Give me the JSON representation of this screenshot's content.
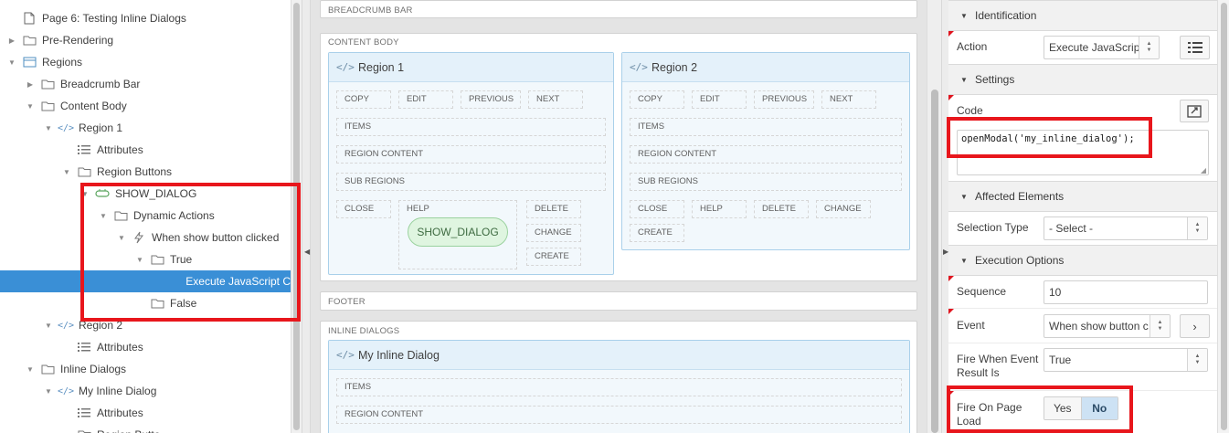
{
  "tree": {
    "items": [
      {
        "label": "Page 6: Testing Inline Dialogs",
        "icon": "page-icon",
        "level": 0,
        "toggle": "none"
      },
      {
        "label": "Pre-Rendering",
        "icon": "folder-icon",
        "level": 0,
        "toggle": "collapsed"
      },
      {
        "label": "Regions",
        "icon": "regions-icon",
        "level": 0,
        "toggle": "expanded"
      },
      {
        "label": "Breadcrumb Bar",
        "icon": "folder-icon",
        "level": 1,
        "toggle": "collapsed"
      },
      {
        "label": "Content Body",
        "icon": "folder-icon",
        "level": 1,
        "toggle": "expanded"
      },
      {
        "label": "Region 1",
        "icon": "code-icon",
        "level": 2,
        "toggle": "expanded"
      },
      {
        "label": "Attributes",
        "icon": "attributes-icon",
        "level": 3,
        "toggle": "none"
      },
      {
        "label": "Region Buttons",
        "icon": "folder-icon",
        "level": 3,
        "toggle": "expanded"
      },
      {
        "label": "SHOW_DIALOG",
        "icon": "button-icon",
        "level": 4,
        "toggle": "expanded"
      },
      {
        "label": "Dynamic Actions",
        "icon": "folder-icon",
        "level": 5,
        "toggle": "expanded"
      },
      {
        "label": "When show button clicked",
        "icon": "lightning-icon",
        "level": 6,
        "toggle": "expanded"
      },
      {
        "label": "True",
        "icon": "folder-icon",
        "level": 7,
        "toggle": "expanded"
      },
      {
        "label": "Execute JavaScript C",
        "icon": "none",
        "level": 8,
        "toggle": "none",
        "selected": true
      },
      {
        "label": "False",
        "icon": "folder-icon",
        "level": 7,
        "toggle": "none"
      },
      {
        "label": "Region 2",
        "icon": "code-icon",
        "level": 2,
        "toggle": "expanded"
      },
      {
        "label": "Attributes",
        "icon": "attributes-icon",
        "level": 3,
        "toggle": "none"
      },
      {
        "label": "Inline Dialogs",
        "icon": "folder-icon",
        "level": 1,
        "toggle": "expanded"
      },
      {
        "label": "My Inline Dialog",
        "icon": "code-icon",
        "level": 2,
        "toggle": "expanded"
      },
      {
        "label": "Attributes",
        "icon": "attributes-icon",
        "level": 3,
        "toggle": "none"
      },
      {
        "label": "Region Butto",
        "icon": "folder-icon",
        "level": 3,
        "toggle": "expanded"
      }
    ]
  },
  "layout": {
    "breadcrumb_bar": "BREADCRUMB BAR",
    "content_body": "CONTENT BODY",
    "region1": {
      "name": "Region 1",
      "top_slots": [
        "COPY",
        "EDIT",
        "PREVIOUS",
        "NEXT"
      ],
      "items": "ITEMS",
      "region_content": "REGION CONTENT",
      "sub_regions": "SUB REGIONS",
      "close": "CLOSE",
      "help": "HELP",
      "button": "SHOW_DIALOG",
      "right_slots": [
        "DELETE",
        "CHANGE",
        "CREATE"
      ]
    },
    "region2": {
      "name": "Region 2",
      "top_slots": [
        "COPY",
        "EDIT",
        "PREVIOUS",
        "NEXT"
      ],
      "items": "ITEMS",
      "region_content": "REGION CONTENT",
      "sub_regions": "SUB REGIONS",
      "bottom_slots": [
        "CLOSE",
        "HELP",
        "DELETE",
        "CHANGE"
      ],
      "create": "CREATE"
    },
    "footer": "FOOTER",
    "inline_dialogs": "INLINE DIALOGS",
    "dialog": {
      "name": "My Inline Dialog",
      "items": "ITEMS",
      "region_content": "REGION CONTENT"
    }
  },
  "props": {
    "identification": {
      "title": "Identification",
      "action_label": "Action",
      "action_value": "Execute JavaScript"
    },
    "settings": {
      "title": "Settings",
      "code_label": "Code",
      "code_value": "openModal('my_inline_dialog');"
    },
    "affected": {
      "title": "Affected Elements",
      "selection_type_label": "Selection Type",
      "selection_type_value": "- Select -"
    },
    "execution": {
      "title": "Execution Options",
      "sequence_label": "Sequence",
      "sequence_value": "10",
      "event_label": "Event",
      "event_value": "When show button c",
      "fire_when_label": "Fire When Event Result Is",
      "fire_when_value": "True",
      "fire_on_load_label": "Fire On Page Load",
      "yes": "Yes",
      "no": "No",
      "fire_on_load_selected": "No"
    }
  },
  "colors": {
    "selection": "#3a8fd6",
    "highlight": "#e8161c",
    "required_marker": "#e0141e"
  }
}
